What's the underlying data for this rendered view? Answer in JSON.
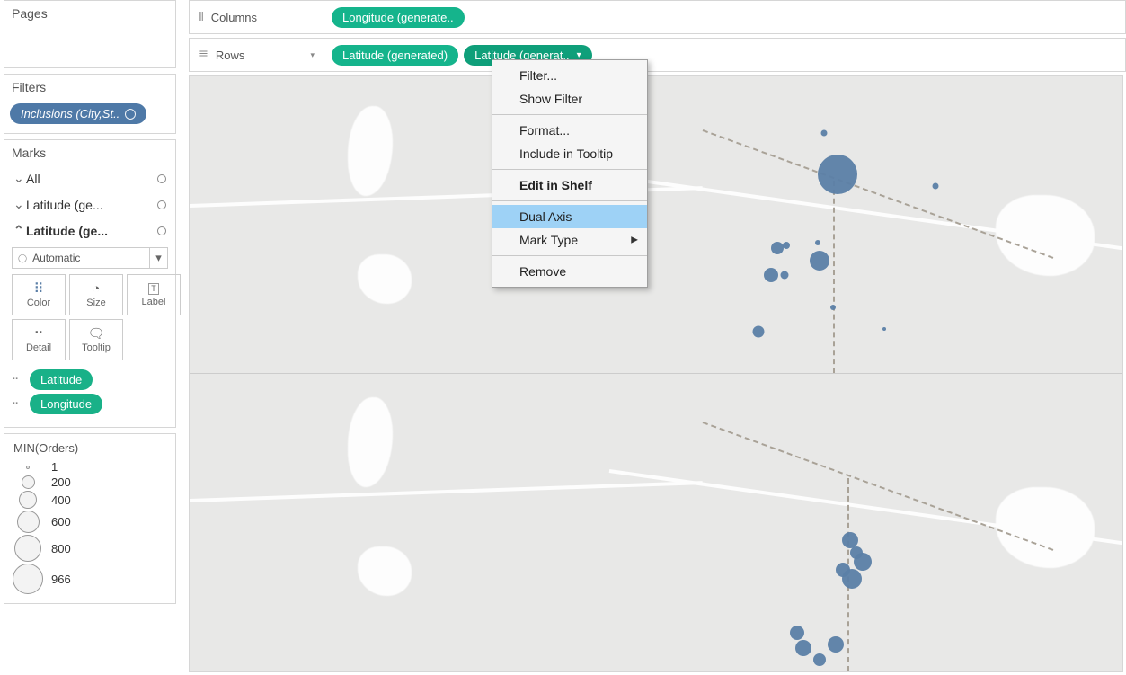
{
  "shelves": {
    "columns_label": "Columns",
    "rows_label": "Rows",
    "columns_pill": "Longitude (generate..",
    "rows_pill1": "Latitude (generated)",
    "rows_pill2": "Latitude (generat.."
  },
  "panels": {
    "pages": "Pages",
    "filters": "Filters",
    "marks": "Marks"
  },
  "filter_pill": "Inclusions (City,St..",
  "marks": {
    "all": "All",
    "lat1": "Latitude (ge...",
    "lat2": "Latitude (ge...",
    "mark_type": "Automatic"
  },
  "cards": {
    "color": "Color",
    "size": "Size",
    "label": "Label",
    "detail": "Detail",
    "tooltip": "Tooltip"
  },
  "mark_pills": {
    "p1": "Latitude",
    "p2": "Longitude"
  },
  "legend": {
    "title": "MIN(Orders)",
    "items": [
      {
        "v": "1",
        "d": 4
      },
      {
        "v": "200",
        "d": 15
      },
      {
        "v": "400",
        "d": 20
      },
      {
        "v": "600",
        "d": 25
      },
      {
        "v": "800",
        "d": 30
      },
      {
        "v": "966",
        "d": 34
      }
    ]
  },
  "context_menu": {
    "filter": "Filter...",
    "show_filter": "Show Filter",
    "format": "Format...",
    "include_tooltip": "Include in Tooltip",
    "edit_shelf": "Edit in Shelf",
    "dual_axis": "Dual Axis",
    "mark_type": "Mark Type",
    "remove": "Remove"
  },
  "chart_data": {
    "type": "scatter",
    "encoding": "map bubble (size = MIN(Orders))",
    "top_panel_points": [
      {
        "x_pct": 69.5,
        "y_pct": 33,
        "size": 44
      },
      {
        "x_pct": 68.0,
        "y_pct": 19,
        "size": 7
      },
      {
        "x_pct": 63.0,
        "y_pct": 58,
        "size": 14
      },
      {
        "x_pct": 64.0,
        "y_pct": 57,
        "size": 8
      },
      {
        "x_pct": 67.5,
        "y_pct": 62,
        "size": 22
      },
      {
        "x_pct": 62.3,
        "y_pct": 67,
        "size": 16
      },
      {
        "x_pct": 63.8,
        "y_pct": 67,
        "size": 9
      },
      {
        "x_pct": 67.3,
        "y_pct": 56,
        "size": 6
      },
      {
        "x_pct": 61.0,
        "y_pct": 86,
        "size": 13
      },
      {
        "x_pct": 69.0,
        "y_pct": 78,
        "size": 6
      },
      {
        "x_pct": 80.0,
        "y_pct": 37,
        "size": 7
      },
      {
        "x_pct": 74.5,
        "y_pct": 85,
        "size": 4
      }
    ],
    "bottom_panel_points": [
      {
        "x_pct": 70.8,
        "y_pct": 56,
        "size": 18
      },
      {
        "x_pct": 71.5,
        "y_pct": 60,
        "size": 14
      },
      {
        "x_pct": 72.2,
        "y_pct": 63,
        "size": 20
      },
      {
        "x_pct": 70.0,
        "y_pct": 66,
        "size": 16
      },
      {
        "x_pct": 71.0,
        "y_pct": 69,
        "size": 22
      },
      {
        "x_pct": 69.3,
        "y_pct": 91,
        "size": 18
      },
      {
        "x_pct": 65.8,
        "y_pct": 92,
        "size": 18
      },
      {
        "x_pct": 67.5,
        "y_pct": 96,
        "size": 14
      },
      {
        "x_pct": 65.1,
        "y_pct": 87,
        "size": 16
      }
    ]
  }
}
